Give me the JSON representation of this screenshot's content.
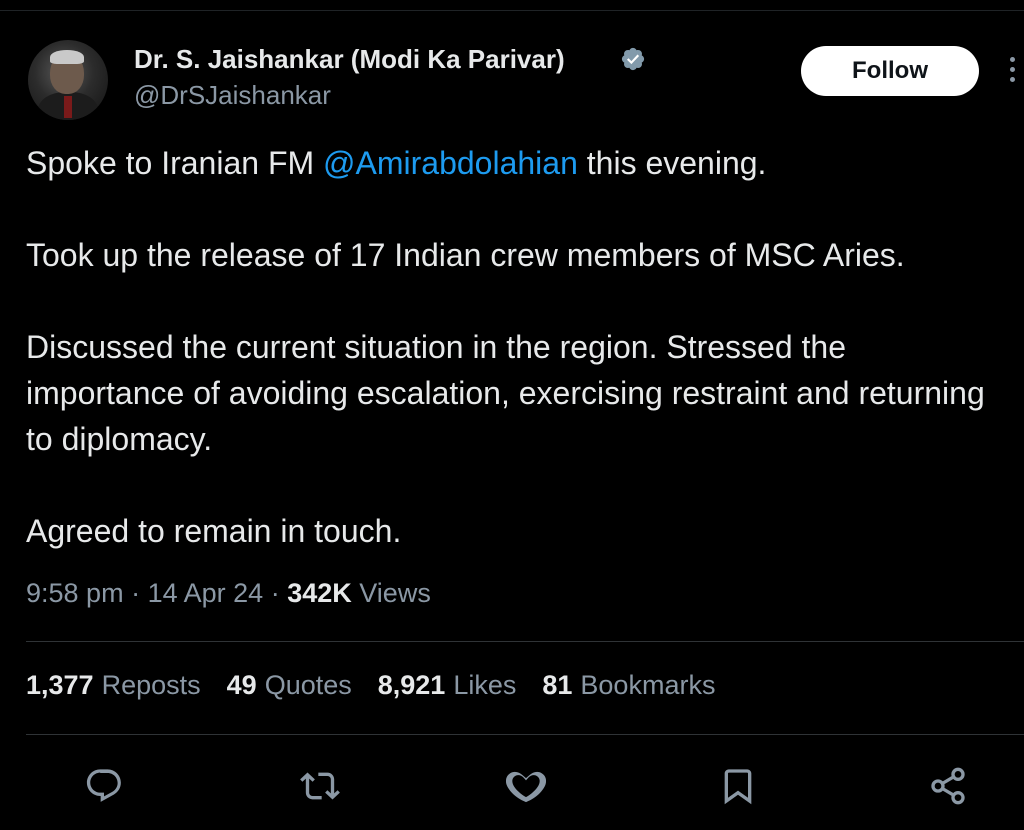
{
  "author": {
    "display_name": "Dr. S. Jaishankar (Modi Ka Parivar)",
    "handle": "@DrSJaishankar",
    "verified_icon": "verified-badge-icon",
    "badge_color": "#829aab"
  },
  "follow_label": "Follow",
  "tweet": {
    "line1_pre": "Spoke to Iranian FM ",
    "line1_mention": "@Amirabdolahian",
    "line1_post": " this evening.",
    "para2": "Took up the release of 17 Indian crew members of MSC Aries.",
    "para3": "Discussed the current situation in the region. Stressed the importance of avoiding escalation, exercising restraint and returning to diplomacy.",
    "para4": "Agreed to remain in touch."
  },
  "meta": {
    "time": "9:58 pm",
    "date": "14 Apr 24",
    "views_count": "342K",
    "views_label": "Views",
    "separator": "·"
  },
  "stats": [
    {
      "count": "1,377",
      "label": "Reposts"
    },
    {
      "count": "49",
      "label": "Quotes"
    },
    {
      "count": "8,921",
      "label": "Likes"
    },
    {
      "count": "81",
      "label": "Bookmarks"
    }
  ],
  "actions": [
    "reply-icon",
    "repost-icon",
    "like-icon",
    "bookmark-icon",
    "share-icon"
  ],
  "colors": {
    "background": "#000000",
    "text": "#e7e9ea",
    "muted": "#8b98a5",
    "link": "#1d9bf0"
  }
}
